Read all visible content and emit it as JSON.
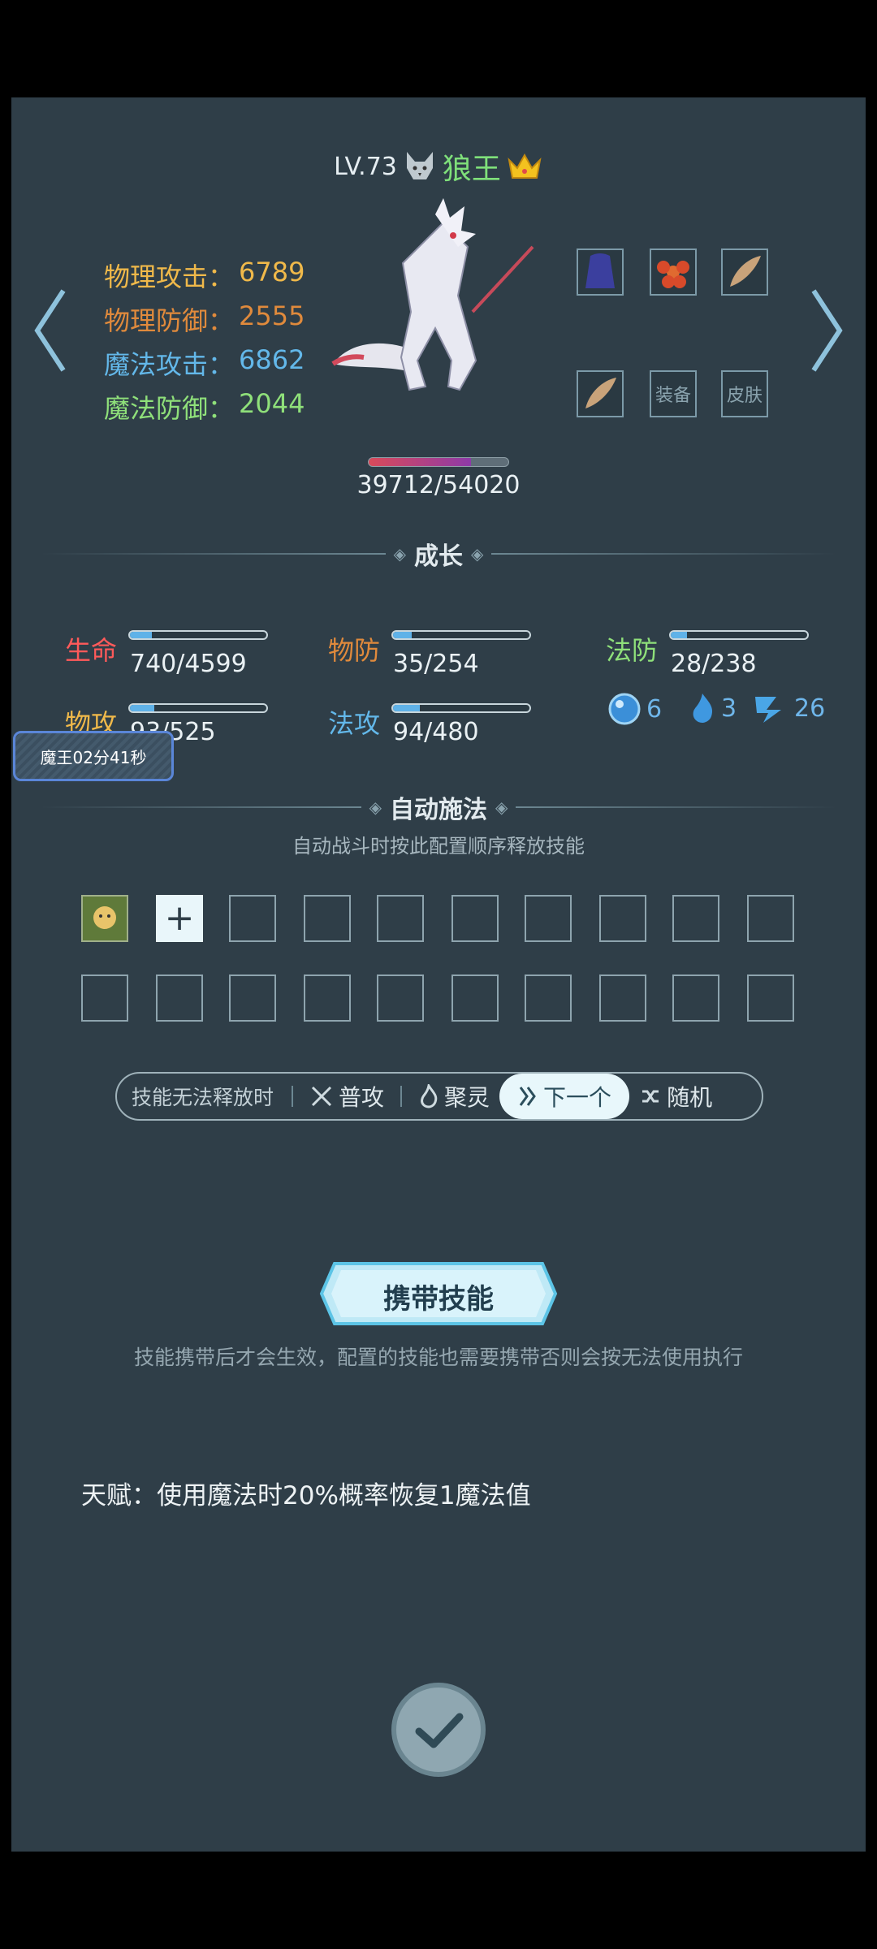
{
  "hero": {
    "level": "LV.73",
    "name": "狼王",
    "hp": "39712/54020",
    "hp_fraction": 0.735
  },
  "stats": {
    "phys_atk_label": "物理攻击：",
    "phys_atk": "6789",
    "phys_def_label": "物理防御：",
    "phys_def": "2555",
    "mag_atk_label": "魔法攻击：",
    "mag_atk": "6862",
    "mag_def_label": "魔法防御：",
    "mag_def": "2044"
  },
  "equipment": {
    "slot_equip_label": "装备",
    "slot_skin_label": "皮肤"
  },
  "growth": {
    "title": "成长",
    "hp_label": "生命",
    "hp_value": "740/4599",
    "hp_fraction": 0.161,
    "pdef_label": "物防",
    "pdef_value": "35/254",
    "pdef_fraction": 0.138,
    "mdef_label": "法防",
    "mdef_value": "28/238",
    "mdef_fraction": 0.118,
    "patk_label": "物攻",
    "patk_value": "93/525",
    "patk_fraction": 0.177,
    "matk_label": "法攻",
    "matk_value": "94/480",
    "matk_fraction": 0.196
  },
  "resources": {
    "orb": "6",
    "flame": "3",
    "rune": "26"
  },
  "timer_badge": "魔王02分41秒",
  "auto_cast": {
    "title": "自动施法",
    "subtitle": "自动战斗时按此配置顺序释放技能"
  },
  "fallback": {
    "label": "技能无法释放时",
    "opt1": "普攻",
    "opt2": "聚灵",
    "opt3": "下一个",
    "opt4": "随机",
    "selected": "下一个"
  },
  "carry": {
    "button_label": "携带技能",
    "note": "技能携带后才会生效，配置的技能也需要携带否则会按无法使用执行"
  },
  "talent": "天赋：使用魔法时20%概率恢复1魔法值",
  "colors": {
    "panel_bg": "#2f3e48",
    "name_green": "#7fe07a",
    "phys_atk": "#f0b94a",
    "phys_def": "#e08a3c",
    "mag_atk": "#63b8ea",
    "mag_def": "#8fe07a",
    "growth_hp": "#ff5a5a"
  }
}
